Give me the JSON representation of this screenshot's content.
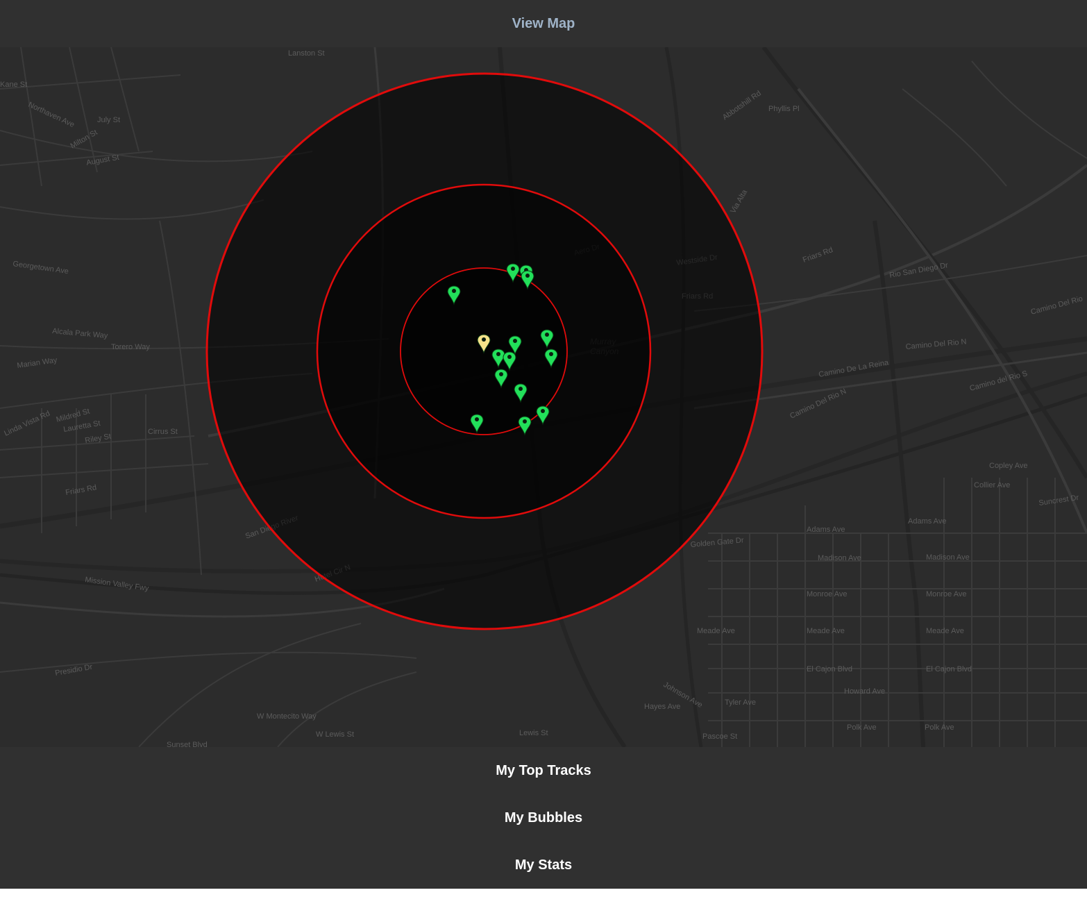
{
  "header": {
    "title": "View Map"
  },
  "menu": {
    "items": [
      {
        "label": "My Top Tracks"
      },
      {
        "label": "My Bubbles"
      },
      {
        "label": "My Stats"
      }
    ]
  },
  "map": {
    "labels": [
      {
        "text": "Lanston St"
      },
      {
        "text": "Kane St"
      },
      {
        "text": "Northaven Ave"
      },
      {
        "text": "July St"
      },
      {
        "text": "Milton St"
      },
      {
        "text": "August St"
      },
      {
        "text": "Georgetown Ave"
      },
      {
        "text": "Alcala Park Way"
      },
      {
        "text": "Torero Way"
      },
      {
        "text": "Marian Way"
      },
      {
        "text": "Linda Vista Rd"
      },
      {
        "text": "Mildred St"
      },
      {
        "text": "Lauretta St"
      },
      {
        "text": "Riley St"
      },
      {
        "text": "Cirrus St"
      },
      {
        "text": "Friars Rd"
      },
      {
        "text": "San Diego River"
      },
      {
        "text": "Mission Valley Fwy"
      },
      {
        "text": "Presidio Dr"
      },
      {
        "text": "W Montecito Way"
      },
      {
        "text": "W Lewis St"
      },
      {
        "text": "Lewis St"
      },
      {
        "text": "Sunset Blvd"
      },
      {
        "text": "Phyllis Pl"
      },
      {
        "text": "Abbotshill Rd"
      },
      {
        "text": "Aero Dr"
      },
      {
        "text": "Friars Rd"
      },
      {
        "text": "Rio San Diego Dr"
      },
      {
        "text": "Camino Del Rio N"
      },
      {
        "text": "Camino De La Reina"
      },
      {
        "text": "Camino del Rio S"
      },
      {
        "text": "Camino Del Rio"
      },
      {
        "text": "Murray"
      },
      {
        "text": "Canyon"
      },
      {
        "text": "Westside Dr"
      },
      {
        "text": "Copley Ave"
      },
      {
        "text": "Collier Ave"
      },
      {
        "text": "Suncrest Dr"
      },
      {
        "text": "Adams Ave"
      },
      {
        "text": "Adams Ave"
      },
      {
        "text": "Golden Gate Dr"
      },
      {
        "text": "Madison Ave"
      },
      {
        "text": "Madison Ave"
      },
      {
        "text": "Monroe Ave"
      },
      {
        "text": "Monroe Ave"
      },
      {
        "text": "Meade Ave"
      },
      {
        "text": "Meade Ave"
      },
      {
        "text": "Meade Ave"
      },
      {
        "text": "El Cajon Blvd"
      },
      {
        "text": "El Cajon Blvd"
      },
      {
        "text": "Howard Ave"
      },
      {
        "text": "Polk Ave"
      },
      {
        "text": "Polk Ave"
      },
      {
        "text": "Tyler Ave"
      },
      {
        "text": "Hayes Ave"
      },
      {
        "text": "Johnson Ave"
      },
      {
        "text": "Pascoe St"
      },
      {
        "text": "Hotel Cir N"
      },
      {
        "text": "Via Alta"
      },
      {
        "text": "Friars Rd"
      },
      {
        "text": "Camino Del Rio N"
      }
    ],
    "rings": [
      {
        "name": "outer-ring"
      },
      {
        "name": "middle-ring"
      },
      {
        "name": "inner-ring"
      }
    ],
    "markers": [
      {
        "type": "user",
        "color": "#f5e28a"
      },
      {
        "type": "bubble",
        "color": "#22e05a"
      },
      {
        "type": "bubble",
        "color": "#22e05a"
      },
      {
        "type": "bubble",
        "color": "#22e05a"
      },
      {
        "type": "bubble",
        "color": "#22e05a"
      },
      {
        "type": "bubble",
        "color": "#22e05a"
      },
      {
        "type": "bubble",
        "color": "#22e05a"
      },
      {
        "type": "bubble",
        "color": "#22e05a"
      },
      {
        "type": "bubble",
        "color": "#22e05a"
      },
      {
        "type": "bubble",
        "color": "#22e05a"
      },
      {
        "type": "bubble",
        "color": "#22e05a"
      },
      {
        "type": "bubble",
        "color": "#22e05a"
      },
      {
        "type": "bubble",
        "color": "#22e05a"
      },
      {
        "type": "bubble",
        "color": "#22e05a"
      },
      {
        "type": "bubble",
        "color": "#22e05a"
      }
    ],
    "ring_color": "#e10b0b"
  }
}
